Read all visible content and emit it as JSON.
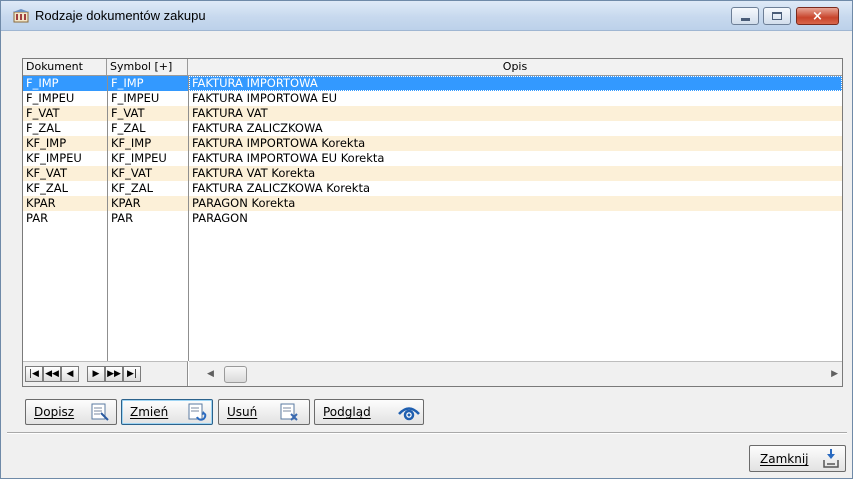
{
  "window": {
    "title": "Rodzaje dokumentów zakupu",
    "controls": {
      "minimize": "minimize",
      "maximize": "maximize",
      "close": "×"
    }
  },
  "table": {
    "columns": [
      "Dokument",
      "Symbol [+]",
      "Opis"
    ],
    "rows": [
      {
        "dokument": "F_IMP",
        "symbol": "F_IMP",
        "opis": "FAKTURA IMPORTOWA",
        "selected": true
      },
      {
        "dokument": "F_IMPEU",
        "symbol": "F_IMPEU",
        "opis": "FAKTURA IMPORTOWA EU"
      },
      {
        "dokument": "F_VAT",
        "symbol": "F_VAT",
        "opis": "FAKTURA VAT"
      },
      {
        "dokument": "F_ZAL",
        "symbol": "F_ZAL",
        "opis": "FAKTURA ZALICZKOWA"
      },
      {
        "dokument": "KF_IMP",
        "symbol": "KF_IMP",
        "opis": "FAKTURA IMPORTOWA Korekta"
      },
      {
        "dokument": "KF_IMPEU",
        "symbol": "KF_IMPEU",
        "opis": "FAKTURA IMPORTOWA EU Korekta"
      },
      {
        "dokument": "KF_VAT",
        "symbol": "KF_VAT",
        "opis": "FAKTURA VAT Korekta"
      },
      {
        "dokument": "KF_ZAL",
        "symbol": "KF_ZAL",
        "opis": "FAKTURA ZALICZKOWA Korekta"
      },
      {
        "dokument": "KPAR",
        "symbol": "KPAR",
        "opis": "PARAGON Korekta"
      },
      {
        "dokument": "PAR",
        "symbol": "PAR",
        "opis": "PARAGON"
      }
    ],
    "navigator": [
      "|◀",
      "◀◀",
      "◀",
      "▶",
      "▶▶",
      "▶|"
    ]
  },
  "buttons": {
    "dopisz": "Dopisz",
    "zmien": "Zmień",
    "usun": "Usuń",
    "podglad": "Podgląd",
    "zamknij": "Zamknij"
  },
  "colors": {
    "selection": "#3399ff",
    "alt_row": "#fcf0d8"
  }
}
